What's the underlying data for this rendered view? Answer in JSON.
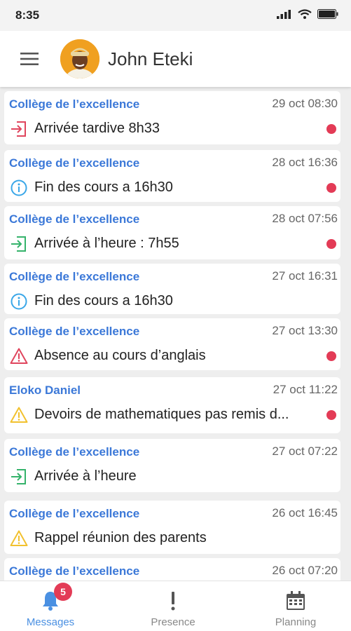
{
  "status_bar": {
    "time": "8:35"
  },
  "header": {
    "user_name": "John Eteki"
  },
  "messages": [
    {
      "source": "Collège de l’excellence",
      "date": "29 oct 08:30",
      "text": "Arrivée tardive 8h33",
      "icon": "login-icon",
      "icon_color": "#e0455d",
      "unread": true
    },
    {
      "source": "Collège de l’excellence",
      "date": "28 oct 16:36",
      "text": "Fin des cours a 16h30",
      "icon": "info-icon",
      "icon_color": "#3aa7e8",
      "unread": true
    },
    {
      "source": "Collège de l’excellence",
      "date": "28 oct 07:56",
      "text": "Arrivée à l’heure : 7h55",
      "icon": "login-icon",
      "icon_color": "#35b36b",
      "unread": true
    },
    {
      "source": "Collège de l’excellence",
      "date": "27 oct 16:31",
      "text": "Fin des cours a 16h30",
      "icon": "info-icon",
      "icon_color": "#3aa7e8",
      "unread": false
    },
    {
      "source": "Collège de l’excellence",
      "date": "27 oct 13:30",
      "text": "Absence au cours d’anglais",
      "icon": "warning-icon",
      "icon_color": "#e0455d",
      "unread": true
    },
    {
      "source": "Eloko Daniel",
      "date": "27 oct 11:22",
      "text": "Devoirs de mathematiques pas remis d...",
      "icon": "warning-icon",
      "icon_color": "#f2c12e",
      "unread": true
    },
    {
      "source": "Collège de l’excellence",
      "date": "27 oct 07:22",
      "text": "Arrivée à l’heure",
      "icon": "login-icon",
      "icon_color": "#35b36b",
      "unread": false
    },
    {
      "source": "Collège de l’excellence",
      "date": "26 oct 16:45",
      "text": "Rappel réunion des parents",
      "icon": "warning-icon",
      "icon_color": "#f2c12e",
      "unread": false
    },
    {
      "source": "Collège de l’excellence",
      "date": "26 oct 07:20",
      "text": "",
      "icon": "",
      "icon_color": "",
      "unread": false
    }
  ],
  "bottom_nav": {
    "messages": {
      "label": "Messages",
      "badge": "5",
      "icon": "bell-icon"
    },
    "presence": {
      "label": "Presence",
      "icon": "exclamation-icon"
    },
    "planning": {
      "label": "Planning",
      "icon": "calendar-icon"
    }
  },
  "colors": {
    "accent": "#4a90e2",
    "source_text": "#3b78d8",
    "unread": "#e33b56",
    "avatar_bg": "#f0a020"
  }
}
